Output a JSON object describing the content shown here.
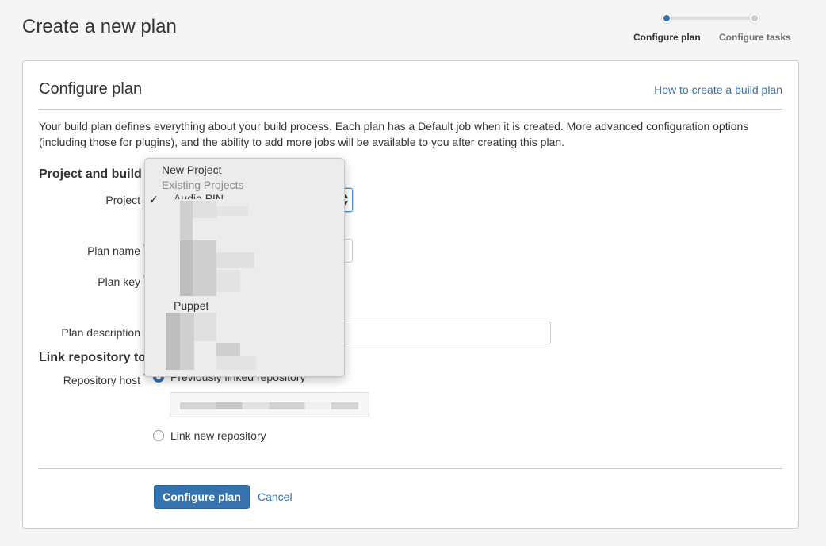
{
  "page": {
    "title": "Create a new plan"
  },
  "tracker": {
    "steps": [
      {
        "label": "Configure plan",
        "active": true
      },
      {
        "label": "Configure tasks",
        "active": false
      }
    ],
    "active_color": "#3572b0"
  },
  "panel": {
    "title": "Configure plan",
    "help_link": "How to create a build plan",
    "intro": "Your build plan defines everything about your build process. Each plan has a Default job when it is created. More advanced configuration options (including those for plugins), and the ability to add more jobs will be available to you after creating this plan."
  },
  "project_section": {
    "title": "Project and build",
    "project_label": "Project",
    "plan_name_label": "Plan name",
    "plan_key_label": "Plan key",
    "plan_description_label": "Plan description"
  },
  "repo_section": {
    "title": "Link repository to",
    "repository_host_label": "Repository host",
    "previously_linked": "Previously linked repository",
    "link_new": "Link new repository"
  },
  "dropdown": {
    "new_project": "New Project",
    "group_label": "Existing Projects",
    "selected_partial": "Audio PIN",
    "visible_item": "Puppet"
  },
  "actions": {
    "submit": "Configure plan",
    "cancel": "Cancel"
  },
  "colors": {
    "primary": "#3572b0",
    "required": "#d04437"
  }
}
